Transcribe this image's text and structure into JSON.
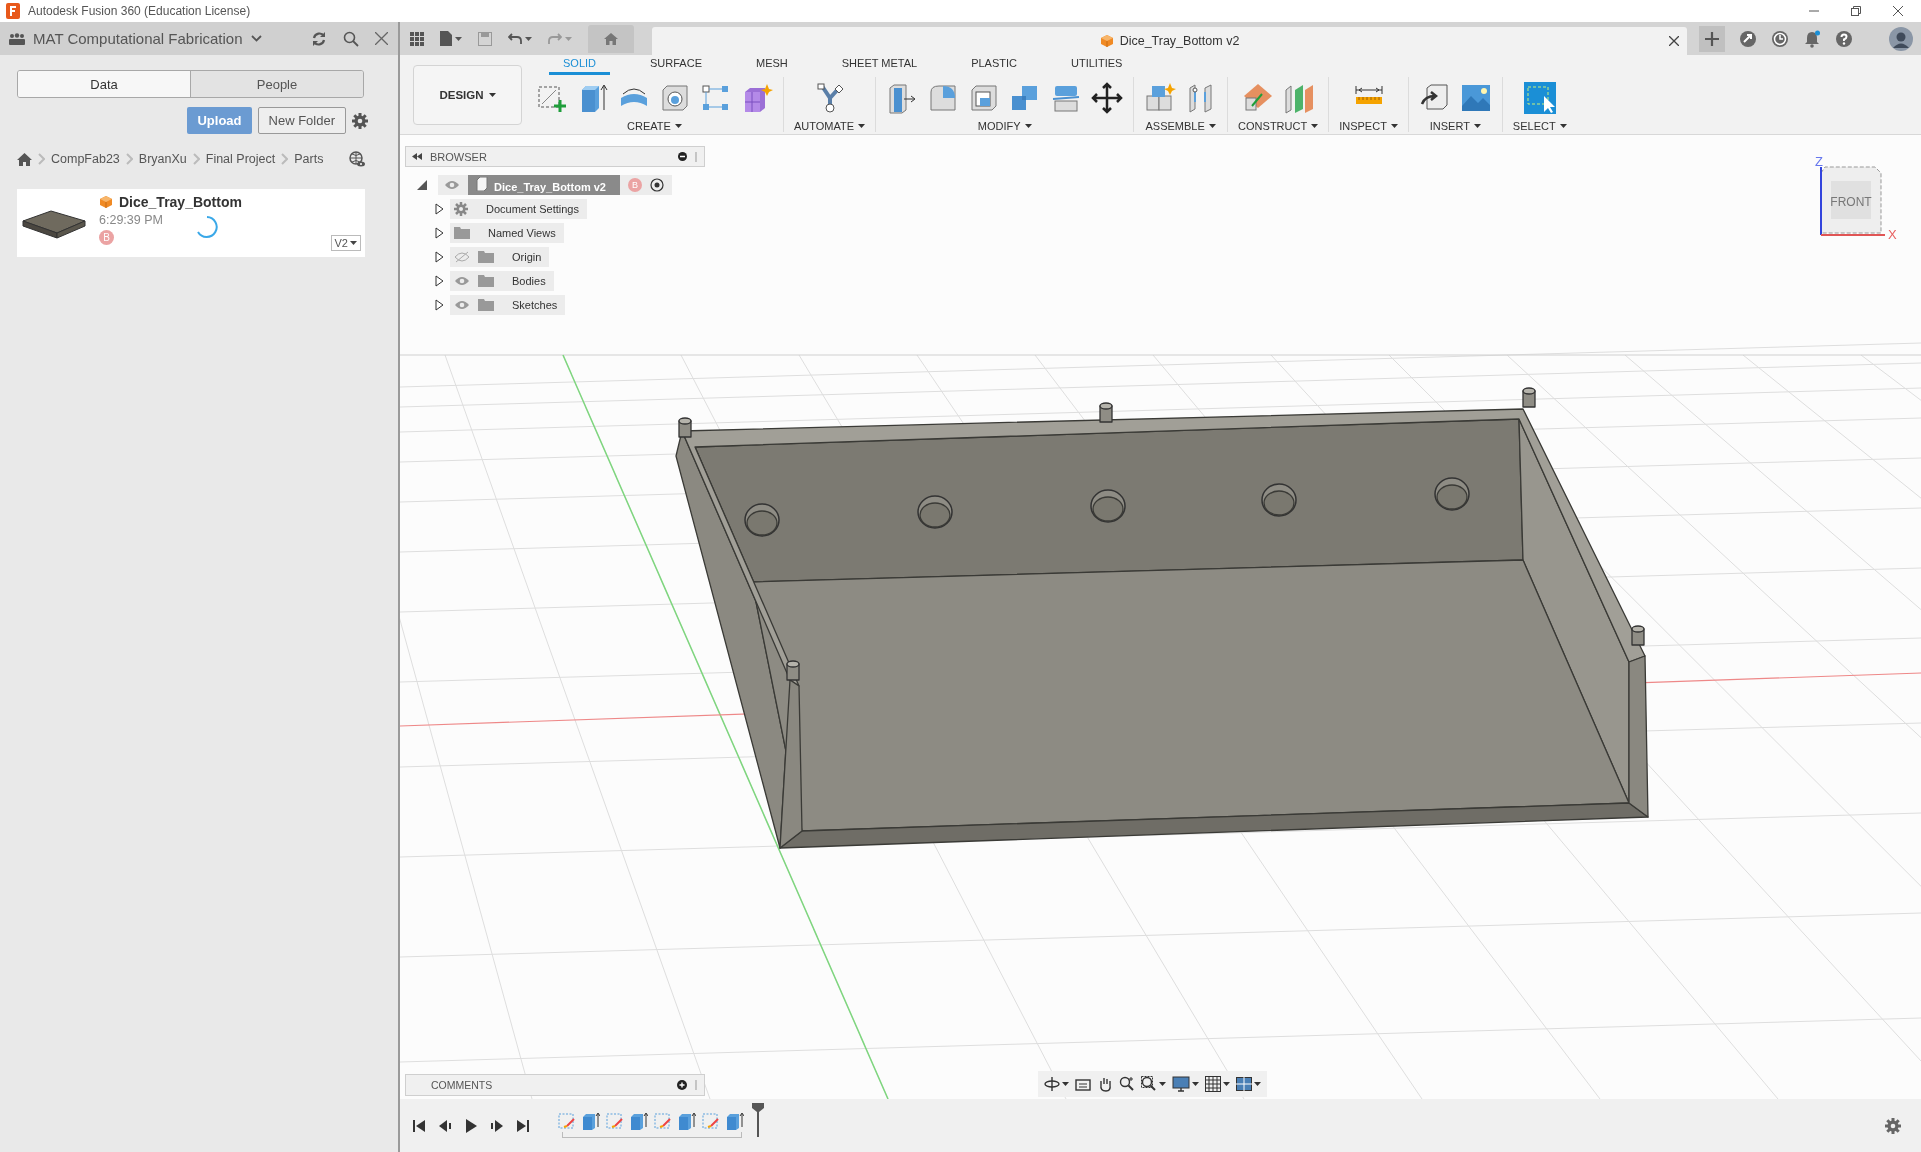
{
  "window": {
    "title": "Autodesk Fusion 360 (Education License)"
  },
  "data_panel": {
    "project": "MAT Computational Fabrication",
    "tabs": [
      {
        "label": "Data",
        "selected": true
      },
      {
        "label": "People",
        "selected": false
      }
    ],
    "upload": "Upload",
    "new_folder": "New Folder",
    "breadcrumb": [
      "CompFab23",
      "BryanXu",
      "Final Project",
      "Parts"
    ],
    "files": [
      {
        "name": "Dice_Tray_Bottom",
        "time": "6:29:39 PM",
        "avatar": "B",
        "version": "V2"
      }
    ]
  },
  "document_tab": {
    "title": "Dice_Tray_Bottom v2"
  },
  "toolbar": {
    "workspace": "DESIGN",
    "tabs": [
      {
        "label": "SOLID",
        "selected": true
      },
      {
        "label": "SURFACE",
        "selected": false
      },
      {
        "label": "MESH",
        "selected": false
      },
      {
        "label": "SHEET METAL",
        "selected": false
      },
      {
        "label": "PLASTIC",
        "selected": false
      },
      {
        "label": "UTILITIES",
        "selected": false
      }
    ],
    "groups": [
      {
        "label": "CREATE",
        "tools": [
          {
            "kind": "sketch"
          },
          {
            "kind": "extrude"
          },
          {
            "kind": "revolve"
          },
          {
            "kind": "hole"
          },
          {
            "kind": "pattern"
          },
          {
            "kind": "form"
          }
        ]
      },
      {
        "label": "AUTOMATE",
        "tools": [
          {
            "kind": "automate"
          }
        ]
      },
      {
        "label": "MODIFY",
        "tools": [
          {
            "kind": "presspull"
          },
          {
            "kind": "fillet"
          },
          {
            "kind": "shell"
          },
          {
            "kind": "combine"
          },
          {
            "kind": "split"
          },
          {
            "kind": "move"
          }
        ]
      },
      {
        "label": "ASSEMBLE",
        "tools": [
          {
            "kind": "component"
          },
          {
            "kind": "joint"
          }
        ]
      },
      {
        "label": "CONSTRUCT",
        "tools": [
          {
            "kind": "plane"
          },
          {
            "kind": "midplane"
          }
        ]
      },
      {
        "label": "INSPECT",
        "tools": [
          {
            "kind": "measure"
          }
        ]
      },
      {
        "label": "INSERT",
        "tools": [
          {
            "kind": "insert"
          },
          {
            "kind": "canvas"
          }
        ]
      },
      {
        "label": "SELECT",
        "tools": [
          {
            "kind": "select"
          }
        ]
      }
    ]
  },
  "browser": {
    "title": "BROWSER",
    "root": {
      "label": "Dice_Tray_Bottom v2",
      "avatar": "B",
      "visible": true,
      "expanded": true,
      "children": [
        {
          "label": "Document Settings",
          "kind": "settings",
          "expanded": false
        },
        {
          "label": "Named Views",
          "kind": "views",
          "expanded": false
        },
        {
          "label": "Origin",
          "kind": "folder",
          "visible": false,
          "expanded": false
        },
        {
          "label": "Bodies",
          "kind": "folder",
          "visible": true,
          "expanded": false
        },
        {
          "label": "Sketches",
          "kind": "folder",
          "visible": true,
          "expanded": false
        }
      ]
    }
  },
  "viewcube": {
    "face": "FRONT",
    "z_label": "Z",
    "x_label": "X"
  },
  "comments": {
    "title": "COMMENTS"
  },
  "timeline": {
    "features": [
      {
        "kind": "sketch"
      },
      {
        "kind": "extrude"
      },
      {
        "kind": "sketch"
      },
      {
        "kind": "extrude"
      },
      {
        "kind": "sketch"
      },
      {
        "kind": "extrude"
      },
      {
        "kind": "sketch"
      },
      {
        "kind": "extrude"
      }
    ]
  }
}
